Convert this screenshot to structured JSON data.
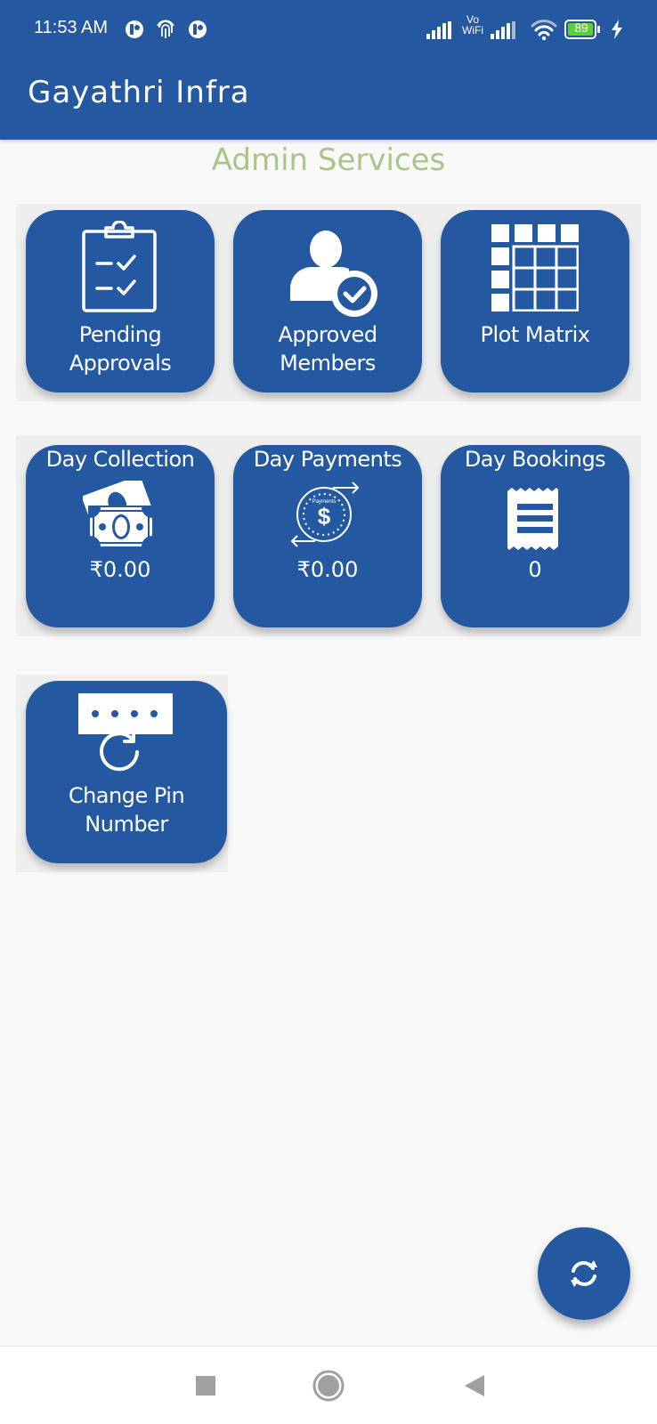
{
  "status_bar": {
    "time": "11:53 AM",
    "battery_level": "89",
    "icons": [
      "notification-icon",
      "fingerprint-icon",
      "notification-icon",
      "signal-icon",
      "vowifi-icon",
      "signal-icon",
      "wifi-icon",
      "battery-icon",
      "charging-icon"
    ],
    "vowifi_top": "Vo",
    "vowifi_bottom": "WiFi"
  },
  "app_bar": {
    "title": "Gayathri Infra"
  },
  "section": {
    "title": "Admin Services"
  },
  "tiles": [
    {
      "id": "pending-approvals",
      "label_line1": "Pending",
      "label_line2": "Approvals",
      "icon": "clipboard-check-icon"
    },
    {
      "id": "approved-members",
      "label_line1": "Approved",
      "label_line2": "Members",
      "icon": "user-check-icon"
    },
    {
      "id": "plot-matrix",
      "label_line1": "Plot Matrix",
      "icon": "grid-matrix-icon"
    },
    {
      "id": "day-collection",
      "label": "Day Collection",
      "value": "₹0.00",
      "icon": "cash-icon"
    },
    {
      "id": "day-payments",
      "label": "Day Payments",
      "value": "₹0.00",
      "icon": "payment-cycle-icon",
      "icon_text": "Payments"
    },
    {
      "id": "day-bookings",
      "label": "Day Bookings",
      "value": "0",
      "icon": "receipt-icon"
    },
    {
      "id": "change-pin",
      "label_line1": "Change Pin",
      "label_line2": "Number",
      "icon": "pin-reset-icon"
    }
  ],
  "fab": {
    "icon": "refresh-icon"
  },
  "nav_bar": {
    "buttons": [
      "recents",
      "home",
      "back"
    ]
  },
  "colors": {
    "primary": "#2459a1",
    "section_title": "#a9c58a",
    "background": "#f8f8f8",
    "battery_fill": "#5ccf3a"
  }
}
